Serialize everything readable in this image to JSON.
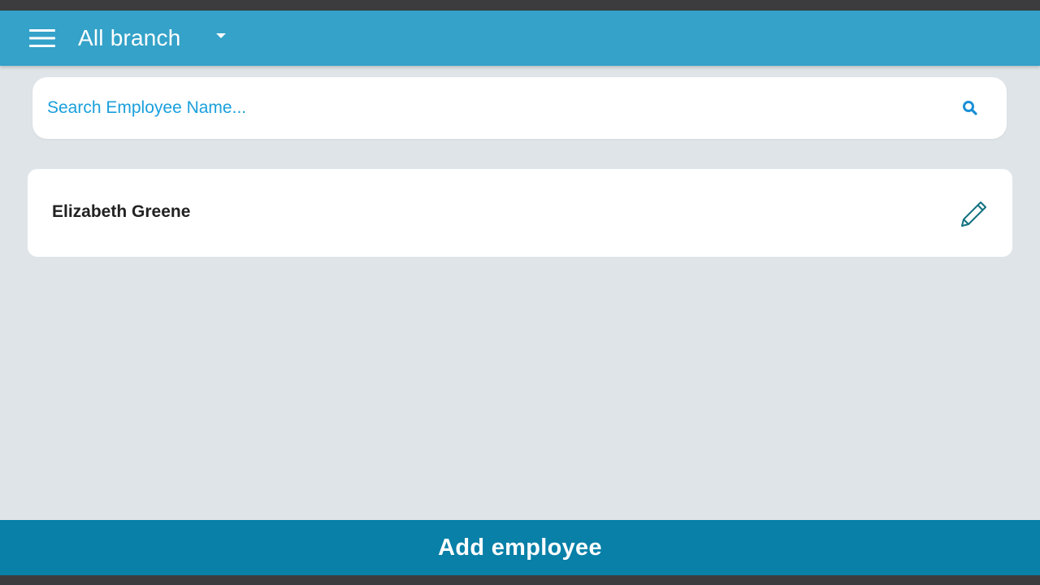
{
  "header": {
    "branch_label": "All branch",
    "menu_icon": "hamburger-menu-icon",
    "dropdown_icon": "caret-down-icon",
    "background_color": "#34a2c9"
  },
  "search": {
    "placeholder": "Search Employee Name...",
    "value": "",
    "icon": "search-icon",
    "text_color": "#1aa0dc"
  },
  "employees": [
    {
      "name": "Elizabeth Greene",
      "action_icon": "edit-pencil-icon"
    }
  ],
  "footer": {
    "add_button_label": "Add employee",
    "background_color": "#0880a8"
  }
}
